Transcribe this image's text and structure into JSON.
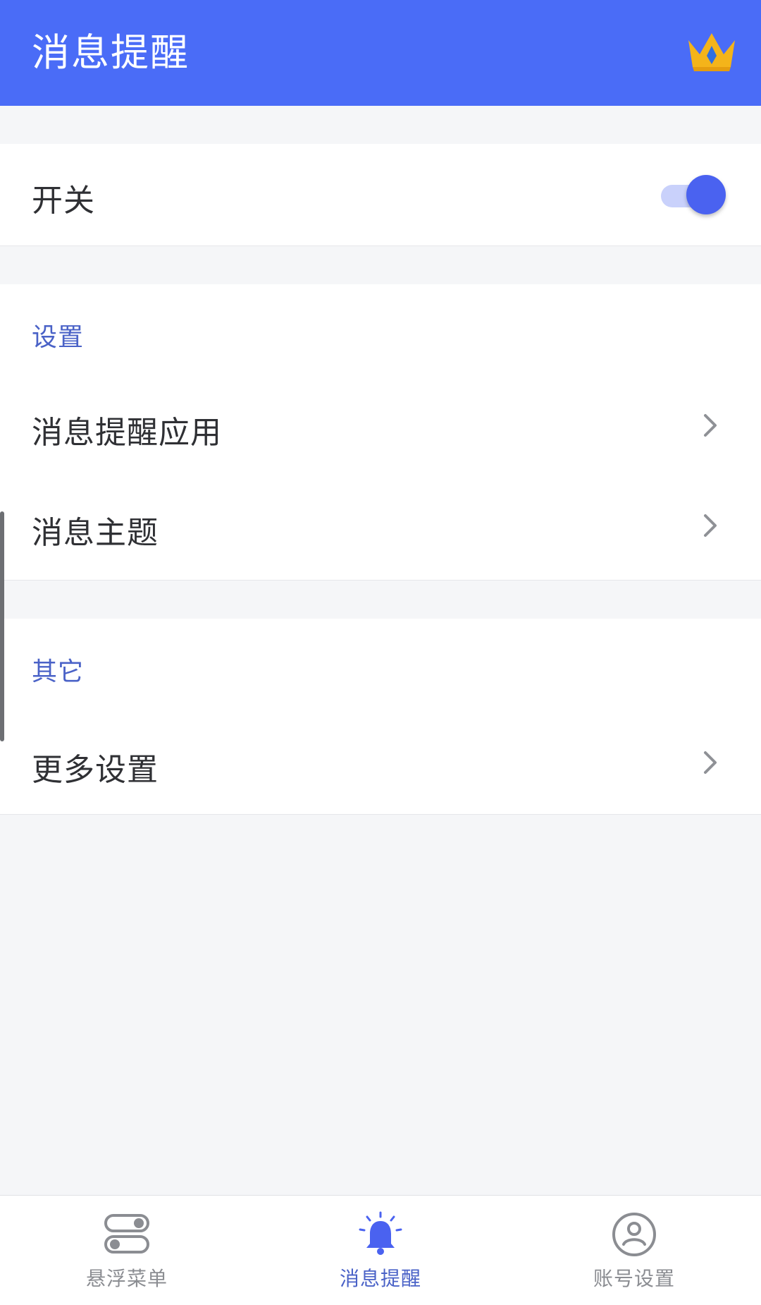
{
  "header": {
    "title": "消息提醒",
    "crown_icon": "crown-icon"
  },
  "switch_section": {
    "label": "开关",
    "toggle_on": true
  },
  "settings_section": {
    "header": "设置",
    "items": [
      {
        "label": "消息提醒应用"
      },
      {
        "label": "消息主题"
      }
    ]
  },
  "other_section": {
    "header": "其它",
    "items": [
      {
        "label": "更多设置"
      }
    ]
  },
  "bottom_nav": {
    "items": [
      {
        "label": "悬浮菜单",
        "icon": "floating-menu-icon",
        "active": false
      },
      {
        "label": "消息提醒",
        "icon": "bell-icon",
        "active": true
      },
      {
        "label": "账号设置",
        "icon": "account-icon",
        "active": false
      }
    ]
  },
  "colors": {
    "accent": "#4a6cf7",
    "section_header": "#4a62c7",
    "crown": "#f4b41a"
  }
}
